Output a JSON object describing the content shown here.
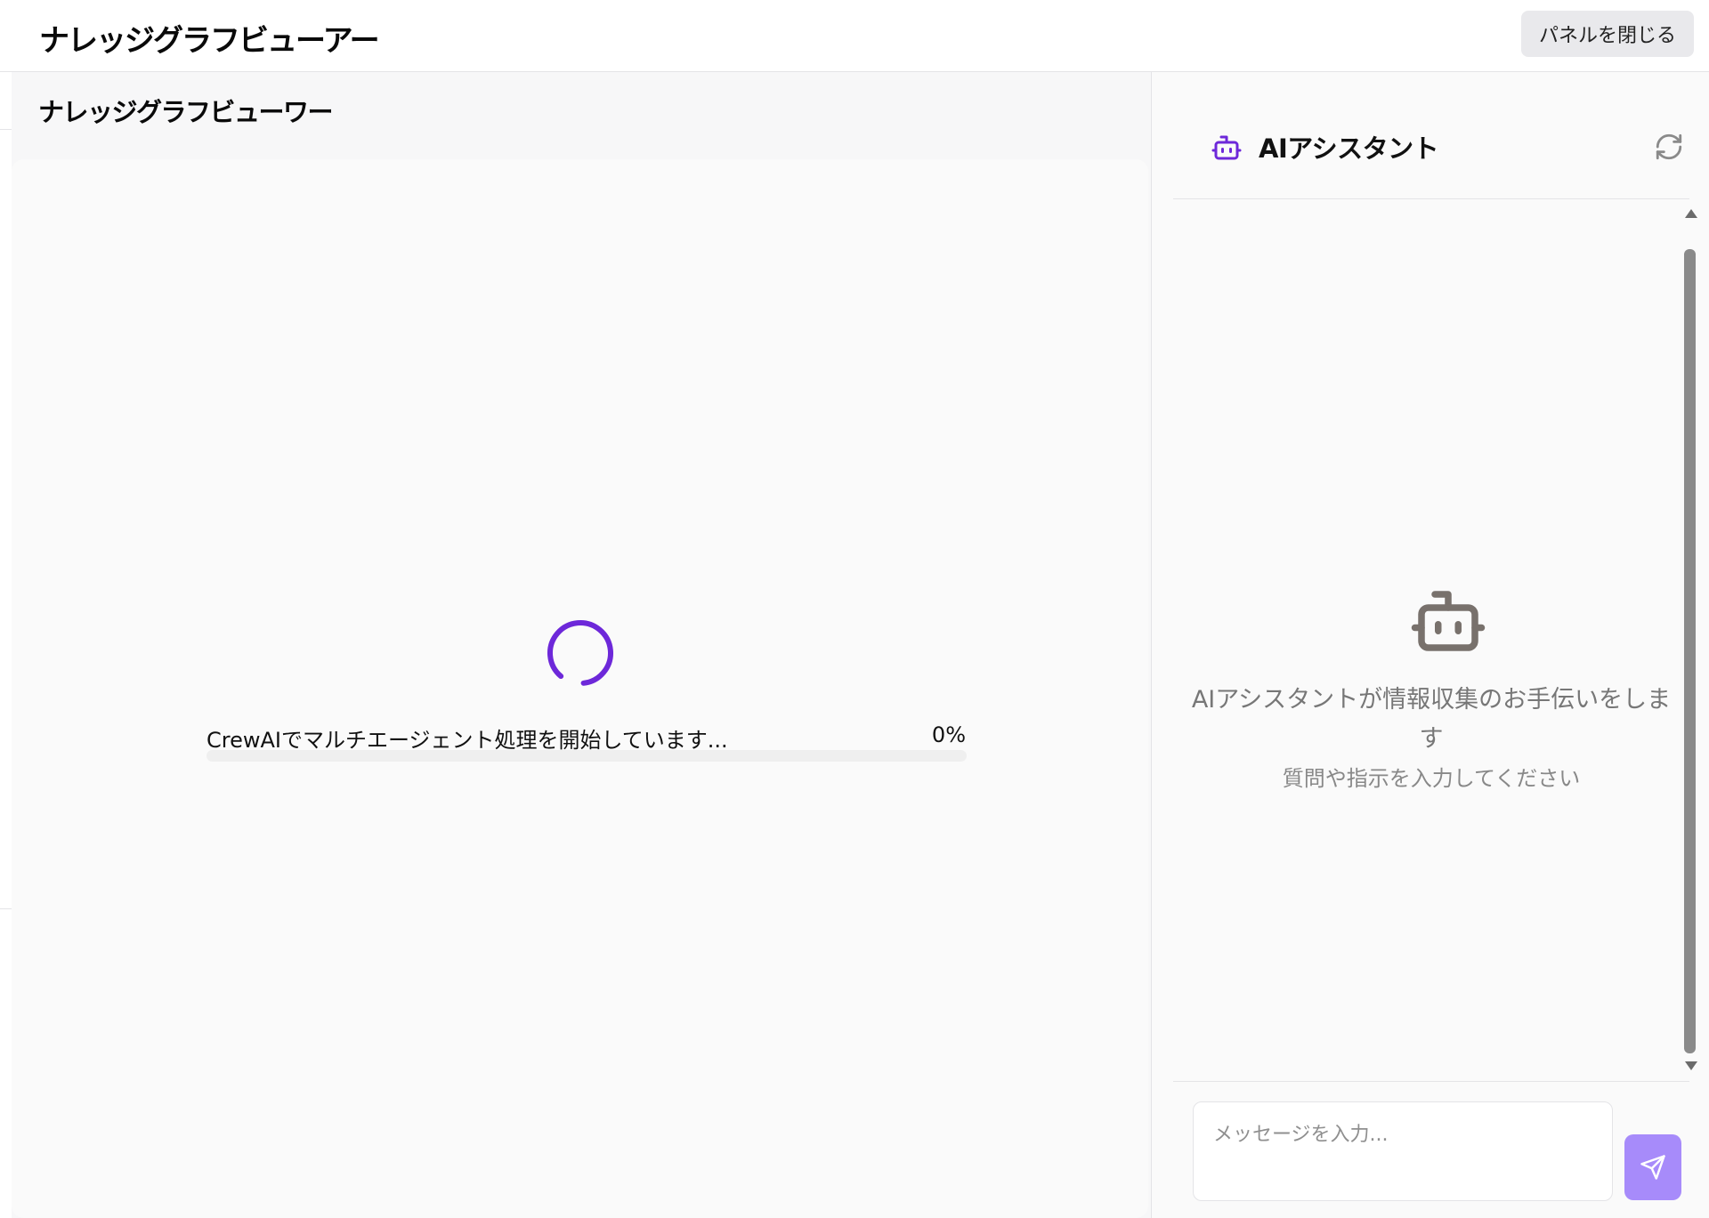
{
  "header": {
    "title": "ナレッジグラフビューアー",
    "close_panel_label": "パネルを閉じる"
  },
  "viewer": {
    "title": "ナレッジグラフビューワー",
    "progress": {
      "label": "CrewAIでマルチエージェント処理を開始しています...",
      "percent_text": "0%",
      "value": 0
    }
  },
  "assistant": {
    "title": "AIアシスタント",
    "empty_state": {
      "title": "AIアシスタントが情報収集のお手伝いをします",
      "subtitle": "質問や指示を入力してください"
    },
    "input": {
      "placeholder": "メッセージを入力...",
      "value": ""
    }
  },
  "icons": {
    "assistant_header": "bot-icon",
    "refresh": "refresh-icon",
    "empty_state": "bot-icon",
    "send": "send-icon",
    "spinner": "loading-spinner"
  },
  "colors": {
    "accent": "#6d28d9",
    "send_button": "#a78bfa",
    "bot_icon_header": "#6d28d9",
    "bot_icon_empty": "#78716c"
  }
}
